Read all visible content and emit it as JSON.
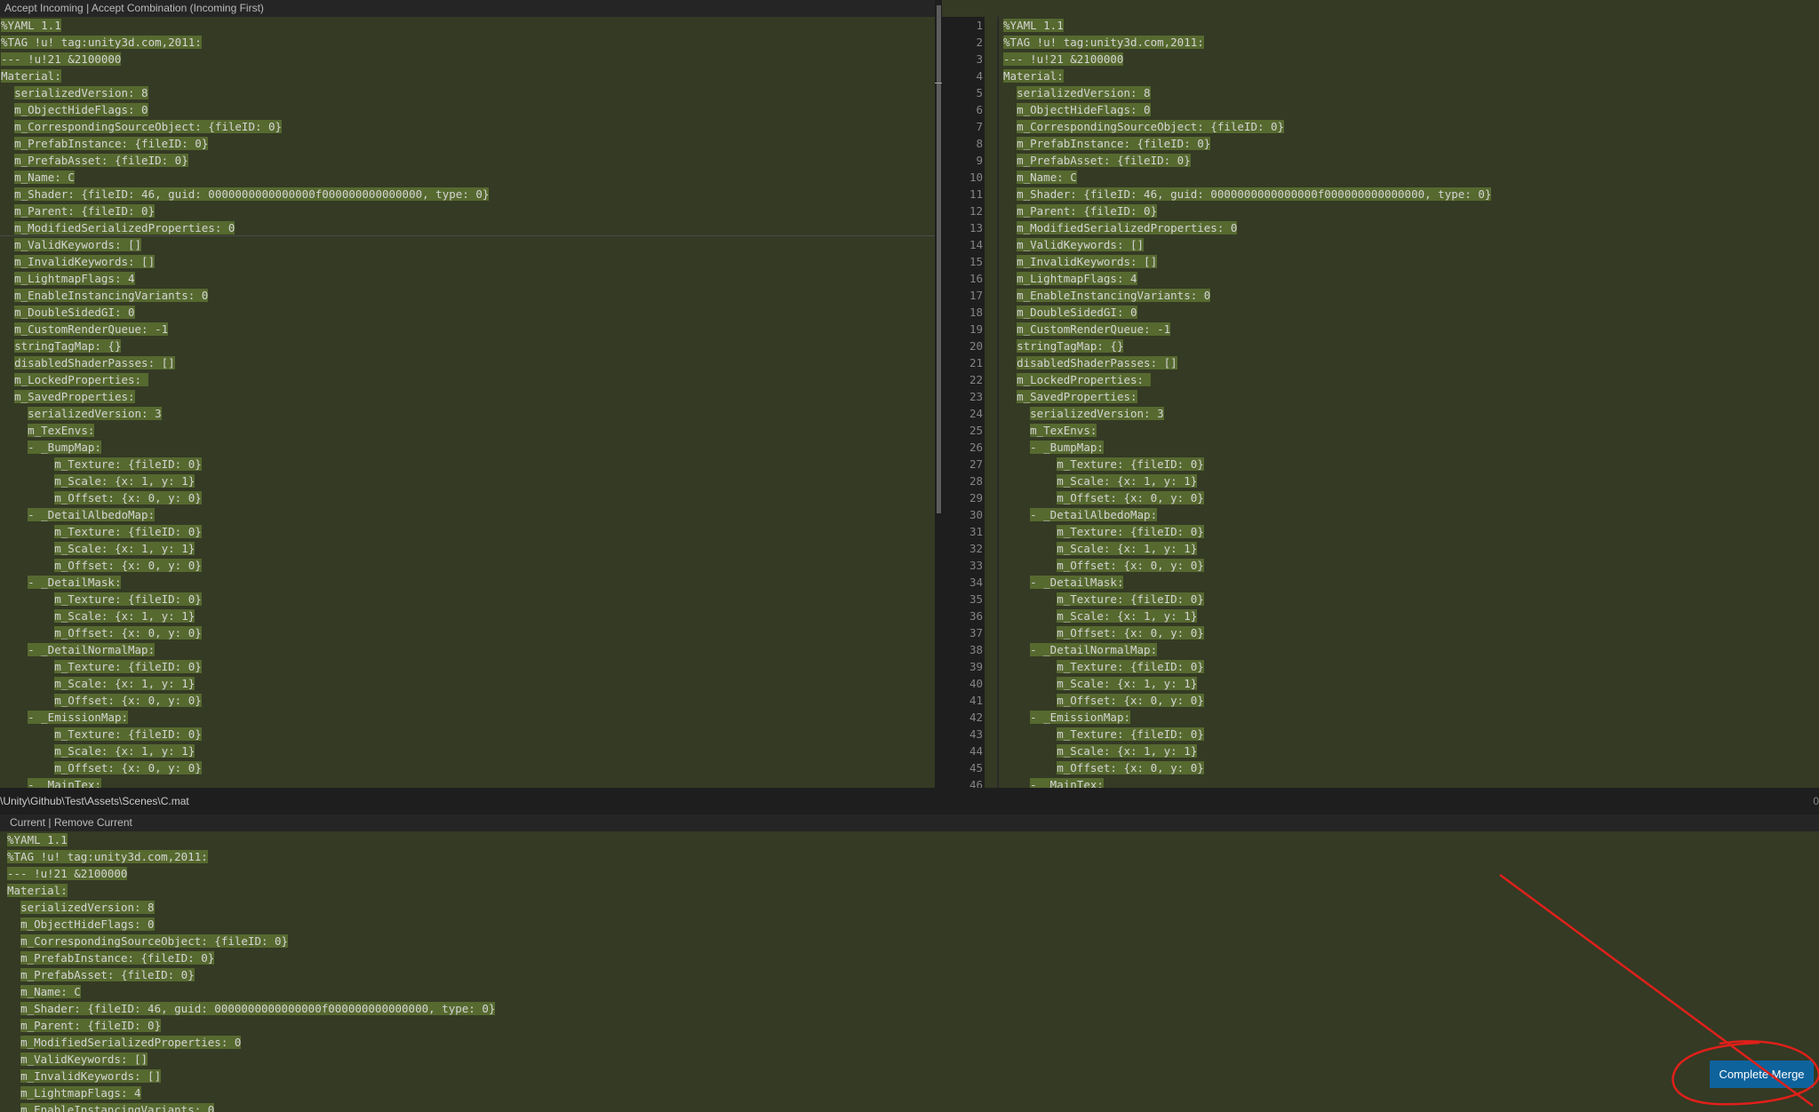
{
  "incoming_header": {
    "accept_incoming": "Accept Incoming",
    "separator": "|",
    "accept_combination": "Accept Combination (Incoming First)"
  },
  "current_header": {
    "current": "Current",
    "separator": "|",
    "remove_current": "Remove Current"
  },
  "status": {
    "file_path": "\\Unity\\Github\\Test\\Assets\\Scenes\\C.mat",
    "right_text": "0"
  },
  "buttons": {
    "complete_merge": "Complete Merge"
  },
  "incoming_lines": [
    "%YAML 1.1",
    "%TAG !u! tag:unity3d.com,2011:",
    "--- !u!21 &2100000",
    "Material:",
    "  serializedVersion: 8",
    "  m_ObjectHideFlags: 0",
    "  m_CorrespondingSourceObject: {fileID: 0}",
    "  m_PrefabInstance: {fileID: 0}",
    "  m_PrefabAsset: {fileID: 0}",
    "  m_Name: C",
    "  m_Shader: {fileID: 46, guid: 0000000000000000f000000000000000, type: 0}",
    "  m_Parent: {fileID: 0}",
    "  m_ModifiedSerializedProperties: 0",
    "  m_ValidKeywords: []",
    "  m_InvalidKeywords: []",
    "  m_LightmapFlags: 4",
    "  m_EnableInstancingVariants: 0",
    "  m_DoubleSidedGI: 0",
    "  m_CustomRenderQueue: -1",
    "  stringTagMap: {}",
    "  disabledShaderPasses: []",
    "  m_LockedProperties: ",
    "  m_SavedProperties:",
    "    serializedVersion: 3",
    "    m_TexEnvs:",
    "    - _BumpMap:",
    "        m_Texture: {fileID: 0}",
    "        m_Scale: {x: 1, y: 1}",
    "        m_Offset: {x: 0, y: 0}",
    "    - _DetailAlbedoMap:",
    "        m_Texture: {fileID: 0}",
    "        m_Scale: {x: 1, y: 1}",
    "        m_Offset: {x: 0, y: 0}",
    "    - _DetailMask:",
    "        m_Texture: {fileID: 0}",
    "        m_Scale: {x: 1, y: 1}",
    "        m_Offset: {x: 0, y: 0}",
    "    - _DetailNormalMap:",
    "        m_Texture: {fileID: 0}",
    "        m_Scale: {x: 1, y: 1}",
    "        m_Offset: {x: 0, y: 0}",
    "    - _EmissionMap:",
    "        m_Texture: {fileID: 0}",
    "        m_Scale: {x: 1, y: 1}",
    "        m_Offset: {x: 0, y: 0}",
    "    - _MainTex:"
  ],
  "result_lines": [
    "%YAML 1.1",
    "%TAG !u! tag:unity3d.com,2011:",
    "--- !u!21 &2100000",
    "Material:",
    "  serializedVersion: 8",
    "  m_ObjectHideFlags: 0",
    "  m_CorrespondingSourceObject: {fileID: 0}",
    "  m_PrefabInstance: {fileID: 0}",
    "  m_PrefabAsset: {fileID: 0}",
    "  m_Name: C",
    "  m_Shader: {fileID: 46, guid: 0000000000000000f000000000000000, type: 0}",
    "  m_Parent: {fileID: 0}",
    "  m_ModifiedSerializedProperties: 0",
    "  m_ValidKeywords: []",
    "  m_InvalidKeywords: []",
    "  m_LightmapFlags: 4",
    "  m_EnableInstancingVariants: 0",
    "  m_DoubleSidedGI: 0",
    "  m_CustomRenderQueue: -1",
    "  stringTagMap: {}",
    "  disabledShaderPasses: []",
    "  m_LockedProperties: ",
    "  m_SavedProperties:",
    "    serializedVersion: 3",
    "    m_TexEnvs:",
    "    - _BumpMap:",
    "        m_Texture: {fileID: 0}",
    "        m_Scale: {x: 1, y: 1}",
    "        m_Offset: {x: 0, y: 0}",
    "    - _DetailAlbedoMap:",
    "        m_Texture: {fileID: 0}",
    "        m_Scale: {x: 1, y: 1}",
    "        m_Offset: {x: 0, y: 0}",
    "    - _DetailMask:",
    "        m_Texture: {fileID: 0}",
    "        m_Scale: {x: 1, y: 1}",
    "        m_Offset: {x: 0, y: 0}",
    "    - _DetailNormalMap:",
    "        m_Texture: {fileID: 0}",
    "        m_Scale: {x: 1, y: 1}",
    "        m_Offset: {x: 0, y: 0}",
    "    - _EmissionMap:",
    "        m_Texture: {fileID: 0}",
    "        m_Scale: {x: 1, y: 1}",
    "        m_Offset: {x: 0, y: 0}",
    "    - _MainTex:"
  ],
  "line_numbers": [
    "1",
    "2",
    "3",
    "4",
    "5",
    "6",
    "7",
    "8",
    "9",
    "10",
    "11",
    "12",
    "13",
    "14",
    "15",
    "16",
    "17",
    "18",
    "19",
    "20",
    "21",
    "22",
    "23",
    "24",
    "25",
    "26",
    "27",
    "28",
    "29",
    "30",
    "31",
    "32",
    "33",
    "34",
    "35",
    "36",
    "37",
    "38",
    "39",
    "40",
    "41",
    "42",
    "43",
    "44",
    "45",
    "46"
  ],
  "current_lines": [
    "%YAML 1.1",
    "%TAG !u! tag:unity3d.com,2011:",
    "--- !u!21 &2100000",
    "Material:",
    "  serializedVersion: 8",
    "  m_ObjectHideFlags: 0",
    "  m_CorrespondingSourceObject: {fileID: 0}",
    "  m_PrefabInstance: {fileID: 0}",
    "  m_PrefabAsset: {fileID: 0}",
    "  m_Name: C",
    "  m_Shader: {fileID: 46, guid: 0000000000000000f000000000000000, type: 0}",
    "  m_Parent: {fileID: 0}",
    "  m_ModifiedSerializedProperties: 0",
    "  m_ValidKeywords: []",
    "  m_InvalidKeywords: []",
    "  m_LightmapFlags: 4",
    "  m_EnableInstancingVariants: 0"
  ],
  "colors": {
    "pane_bg": "#343a24",
    "highlight_bg": "#56692f",
    "button_blue": "#0e639c",
    "annotation_red": "#e0201a"
  }
}
